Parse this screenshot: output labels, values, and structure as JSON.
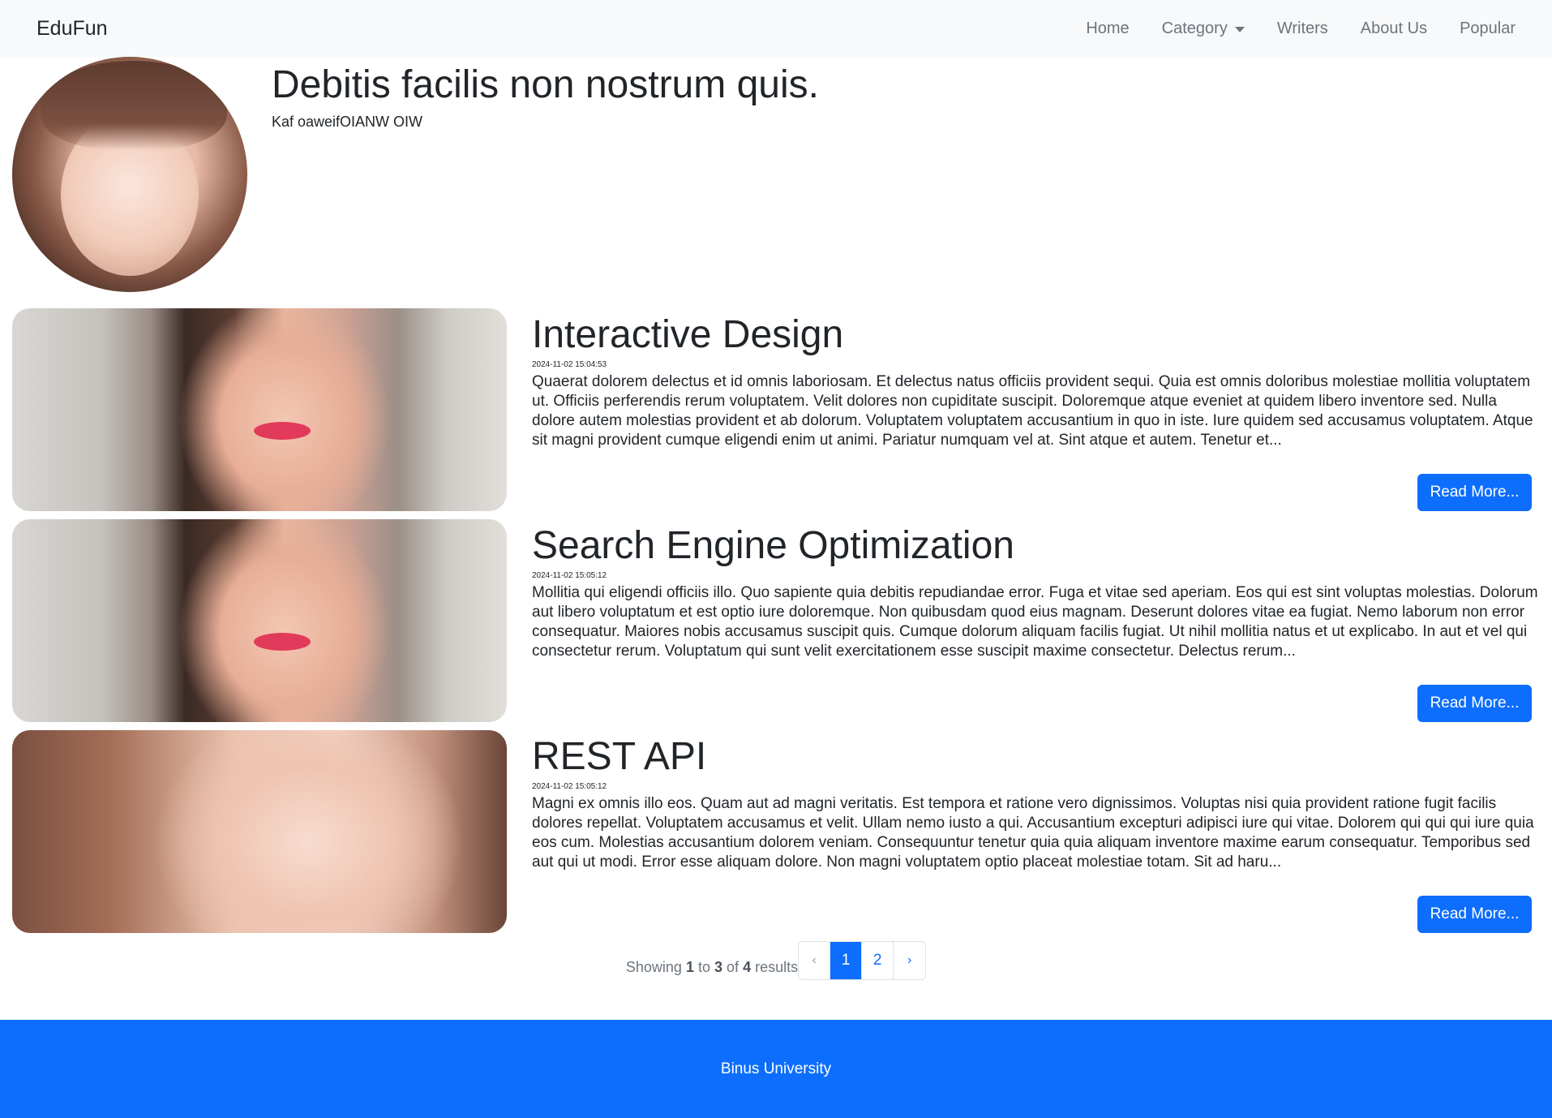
{
  "navbar": {
    "brand": "EduFun",
    "links": [
      "Home",
      "Category",
      "Writers",
      "About Us",
      "Popular"
    ]
  },
  "writer": {
    "name": "Debitis facilis non nostrum quis.",
    "bio": "Kaf oaweifOIANW OIW"
  },
  "articles": [
    {
      "title": "Interactive Design",
      "date": "2024-11-02 15:04:53",
      "excerpt": "Quaerat dolorem delectus et id omnis laboriosam. Et delectus natus officiis provident sequi. Quia est omnis doloribus molestiae mollitia voluptatem ut. Officiis perferendis rerum voluptatem. Velit dolores non cupiditate suscipit. Doloremque atque eveniet at quidem libero inventore sed. Nulla dolore autem molestias provident et ab dolorum. Voluptatem voluptatem accusantium in quo in iste. Iure quidem sed accusamus voluptatem. Atque sit magni provident cumque eligendi enim ut animi. Pariatur numquam vel at. Sint atque et autem. Tenetur et...",
      "button": "Read More..."
    },
    {
      "title": "Search Engine Optimization",
      "date": "2024-11-02 15:05:12",
      "excerpt": "Mollitia qui eligendi officiis illo. Quo sapiente quia debitis repudiandae error. Fuga et vitae sed aperiam. Eos qui est sint voluptas molestias. Dolorum aut libero voluptatum et est optio iure doloremque. Non quibusdam quod eius magnam. Deserunt dolores vitae ea fugiat. Nemo laborum non error consequatur. Maiores nobis accusamus suscipit quis. Cumque dolorum aliquam facilis fugiat. Ut nihil mollitia natus et ut explicabo. In aut et vel qui consectetur rerum. Voluptatum qui sunt velit exercitationem esse suscipit maxime consectetur. Delectus rerum...",
      "button": "Read More..."
    },
    {
      "title": "REST API",
      "date": "2024-11-02 15:05:12",
      "excerpt": "Magni ex omnis illo eos. Quam aut ad magni veritatis. Est tempora et ratione vero dignissimos. Voluptas nisi quia provident ratione fugit facilis dolores repellat. Voluptatem accusamus et velit. Ullam nemo iusto a qui. Accusantium excepturi adipisci iure qui vitae. Dolorem qui qui qui iure quia eos cum. Molestias accusantium dolorem veniam. Consequuntur tenetur quia quia aliquam inventore maxime earum consequatur. Temporibus sed aut qui ut modi. Error esse aliquam dolore. Non magni voluptatem optio placeat molestiae totam. Sit ad haru...",
      "button": "Read More..."
    }
  ],
  "pagination": {
    "showing_prefix": "Showing",
    "from": "1",
    "to_word": "to",
    "to": "3",
    "of_word": "of",
    "total": "4",
    "suffix": "results",
    "prev": "‹",
    "pages": [
      "1",
      "2"
    ],
    "current": "1",
    "next": "›"
  },
  "footer": {
    "text": "Binus University"
  },
  "colors": {
    "primary": "#0d6efd",
    "navbar_bg": "#f8f9fa",
    "muted": "#6c757d"
  }
}
